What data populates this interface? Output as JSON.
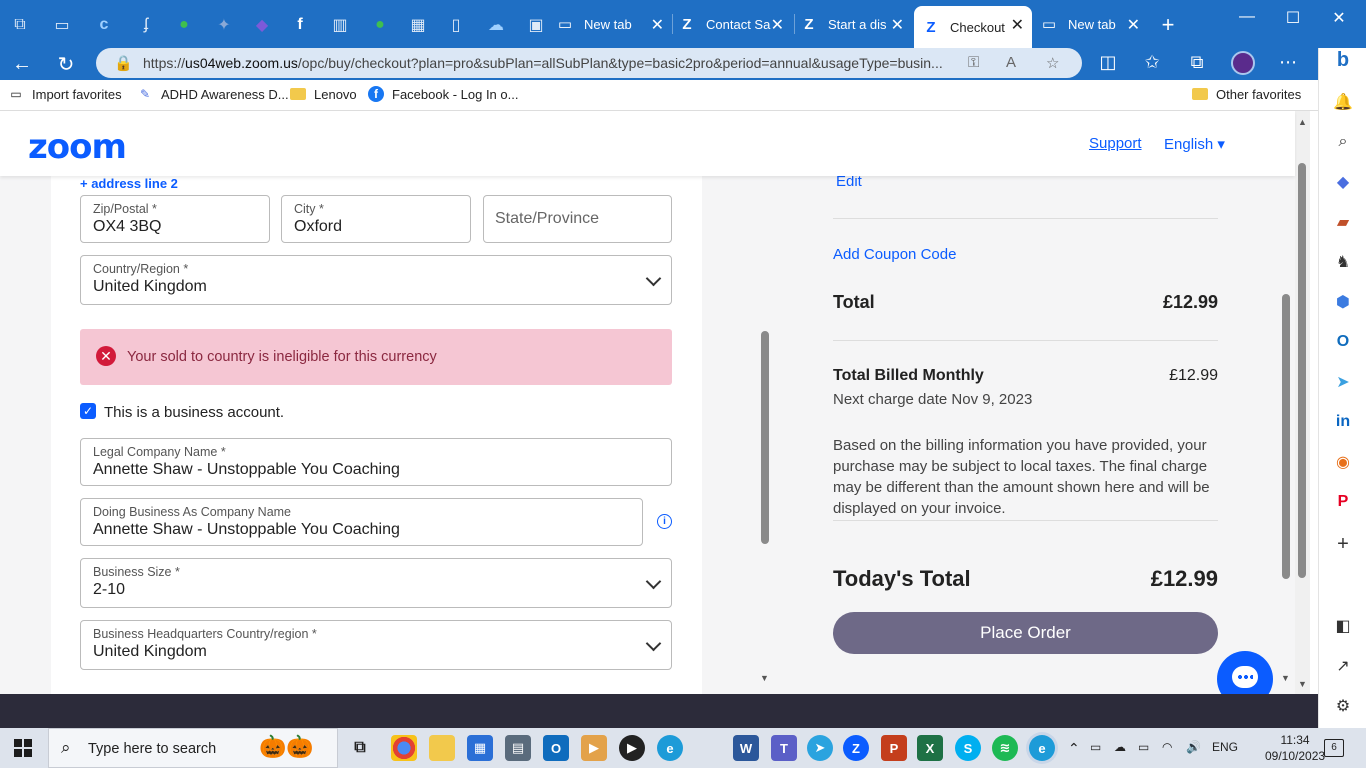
{
  "browser": {
    "tabs": [
      {
        "label": "New tab"
      },
      {
        "label": "Contact Sa"
      },
      {
        "label": "Start a dis"
      },
      {
        "label": "Checkout"
      },
      {
        "label": "New tab"
      }
    ],
    "url_prefix": "https://",
    "url_host": "us04web.zoom.us",
    "url_path": "/opc/buy/checkout?plan=pro&subPlan=allSubPlan&type=basic2pro&period=annual&usageType=busin...",
    "favorites": [
      {
        "label": "Import favorites"
      },
      {
        "label": "ADHD Awareness D..."
      },
      {
        "label": "Lenovo"
      },
      {
        "label": "Facebook - Log In o..."
      }
    ],
    "other_favorites": "Other favorites"
  },
  "header": {
    "logo": "zoom",
    "support": "Support",
    "language": "English ▾"
  },
  "form": {
    "address_line2_link": "+ address line 2",
    "zip": {
      "label": "Zip/Postal *",
      "value": "OX4 3BQ"
    },
    "city": {
      "label": "City *",
      "value": "Oxford"
    },
    "state": {
      "placeholder": "State/Province"
    },
    "country": {
      "label": "Country/Region *",
      "value": "United Kingdom"
    },
    "error": "Your sold to country is ineligible for this currency",
    "business_checkbox": "This is a business account.",
    "legal_name": {
      "label": "Legal Company Name *",
      "value": "Annette Shaw - Unstoppable You Coaching"
    },
    "dba_name": {
      "label": "Doing Business As Company Name",
      "value": "Annette Shaw - Unstoppable You Coaching"
    },
    "business_size": {
      "label": "Business Size *",
      "value": "2-10"
    },
    "hq_country": {
      "label": "Business Headquarters Country/region *",
      "value": "United Kingdom"
    }
  },
  "summary": {
    "edit": "Edit",
    "coupon": "Add Coupon Code",
    "total_label": "Total",
    "total_value": "£12.99",
    "billed_label": "Total Billed Monthly",
    "billed_value": "£12.99",
    "next_charge": "Next charge date Nov 9, 2023",
    "tax_note": "Based on the billing information you have provided, your purchase may be subject to local taxes. The final charge may be different than the amount shown here and will be displayed on your invoice.",
    "today_label": "Today's Total",
    "today_value": "£12.99",
    "place_order": "Place Order"
  },
  "taskbar": {
    "search_placeholder": "Type here to search",
    "language": "ENG",
    "time": "11:34",
    "date": "09/10/2023",
    "notification_count": "6"
  },
  "colors": {
    "browser_blue": "#1f6fc4",
    "zoom_blue": "#0b5cff",
    "error_bg": "#f5c6d3",
    "place_order_bg": "#6e6987"
  }
}
